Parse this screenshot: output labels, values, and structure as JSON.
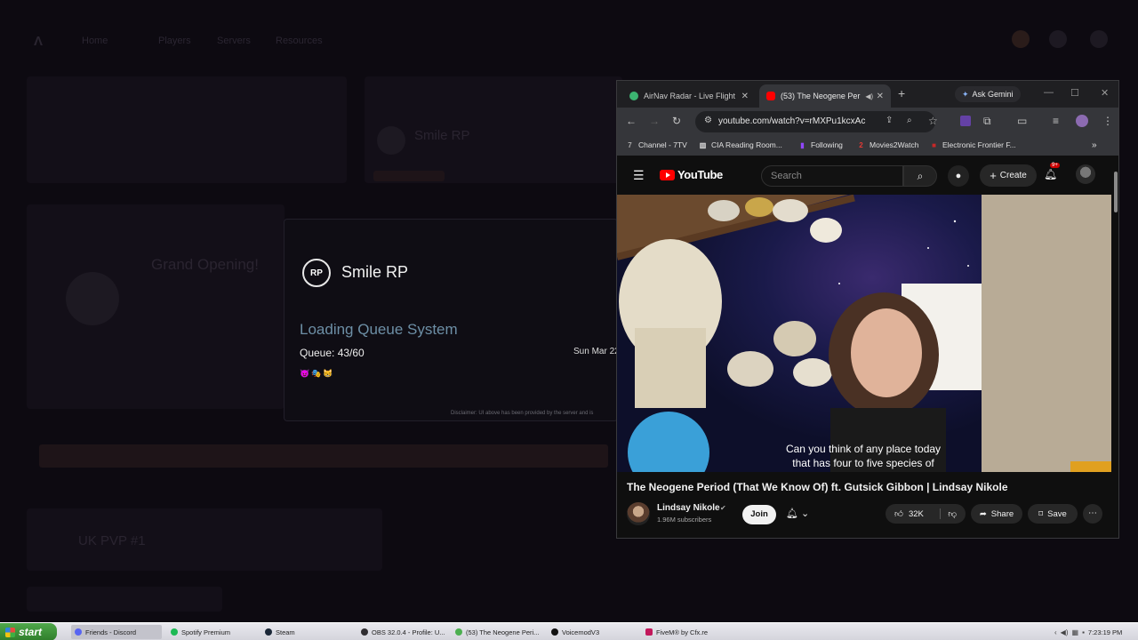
{
  "background": {
    "nav_items": [
      "Home",
      "Players",
      "Servers",
      "Resources"
    ],
    "server_name_faint": "Smile RP",
    "promo_title_faint": "Grand Opening!",
    "lobby_faint": "UK PVP #1"
  },
  "loader": {
    "logo_text": "RP",
    "server_name": "Smile RP",
    "title": "Loading Queue System",
    "queue": "Queue: 43/60",
    "emojis": "😈🎭😸",
    "date": "Sun Mar 22",
    "disclaimer": "Disclaimer: UI above has been provided by the server and is"
  },
  "browser": {
    "tabs": [
      {
        "label": "AirNav Radar - Live Flight",
        "active": false,
        "icon": "airnav-icon",
        "color": "#3cb371"
      },
      {
        "label": "(53) The Neogene Per",
        "active": true,
        "icon": "youtube-icon",
        "color": "#ff0000"
      }
    ],
    "new_tab": "+",
    "ask_gemini": "Ask Gemini",
    "url": "youtube.com/watch?v=rMXPu1kcxAc",
    "bookmarks": [
      {
        "label": "Channel - 7TV",
        "icon": "7tv-icon",
        "glyph": "7",
        "color": "#aaaaaa"
      },
      {
        "label": "CIA Reading Room...",
        "icon": "cia-icon",
        "glyph": "▥",
        "color": "#dddddd"
      },
      {
        "label": "Following",
        "icon": "twitch-icon",
        "glyph": "▮",
        "color": "#9146ff"
      },
      {
        "label": "Movies2Watch",
        "icon": "movies2watch-icon",
        "glyph": "2",
        "color": "#e53935"
      },
      {
        "label": "Electronic Frontier F...",
        "icon": "eff-icon",
        "glyph": "■",
        "color": "#c62828"
      }
    ]
  },
  "youtube": {
    "logo": "YouTube",
    "search_placeholder": "Search",
    "create": "Create",
    "notif_count": "9+",
    "caption_line1": "Can you think of any place today",
    "caption_line2": "that has four to five species of",
    "video_title": "The Neogene Period (That We Know Of) ft. Gutsick Gibbon | Lindsay Nikole",
    "channel_name": "Lindsay Nikole",
    "subscribers": "1.96M subscribers",
    "join": "Join",
    "likes": "32K",
    "share": "Share",
    "save": "Save"
  },
  "taskbar": {
    "start": "start",
    "items": [
      {
        "label": "Friends - Discord",
        "icon": "discord-icon",
        "color": "#5865f2",
        "active": true
      },
      {
        "label": "Spotify Premium",
        "icon": "spotify-icon",
        "color": "#1db954",
        "active": false
      },
      {
        "label": "Steam",
        "icon": "steam-icon",
        "color": "#1b2838",
        "active": false
      },
      {
        "label": "OBS 32.0.4 - Profile: U...",
        "icon": "obs-icon",
        "color": "#302e31",
        "active": false
      },
      {
        "label": "(53) The Neogene Peri...",
        "icon": "chrome-icon",
        "color": "#4caf50",
        "active": false
      },
      {
        "label": "VoicemodV3",
        "icon": "voicemod-icon",
        "color": "#111111",
        "active": false
      },
      {
        "label": "FiveM® by Cfx.re",
        "icon": "fivem-icon",
        "color": "#c2185b",
        "active": false
      }
    ],
    "clock": "7:23:19 PM"
  }
}
